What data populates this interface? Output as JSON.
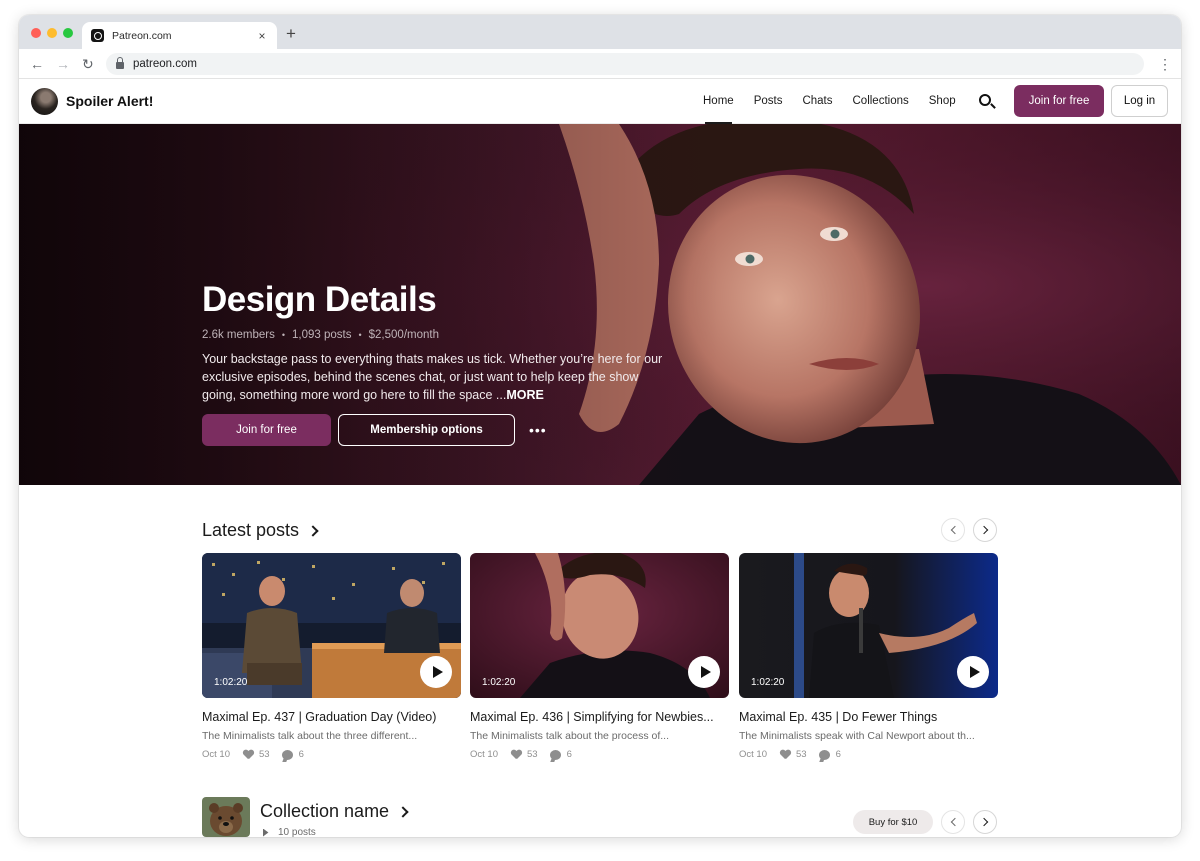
{
  "browser": {
    "tab_title": "Patreon.com",
    "tab_close": "×",
    "new_tab": "+",
    "url": "patreon.com",
    "back": "←",
    "forward": "→",
    "reload": "↻",
    "menu": "⋮"
  },
  "header": {
    "brand": "Spoiler Alert!",
    "nav": [
      "Home",
      "Posts",
      "Chats",
      "Collections",
      "Shop"
    ],
    "active_nav": "Home",
    "join_label": "Join for free",
    "login_label": "Log in"
  },
  "hero": {
    "title": "Design Details",
    "members": "2.6k members",
    "posts": "1,093 posts",
    "price": "$2,500/month",
    "separator": "•",
    "description": "Your backstage pass to everything thats makes us tick. Whether you’re here for our exclusive episodes, behind the scenes chat, or just want to help keep the show going, something more word go here to fill the space ...",
    "more_label": "MORE",
    "join_label": "Join for free",
    "membership_label": "Membership options",
    "more_dots": "•••"
  },
  "latest_posts": {
    "title": "Latest posts",
    "posts": [
      {
        "duration": "1:02:20",
        "title": "Maximal Ep. 437 | Graduation Day (Video)",
        "description": "The Minimalists talk about the three different...",
        "date": "Oct 10",
        "likes": "53",
        "comments": "6"
      },
      {
        "duration": "1:02:20",
        "title": "Maximal Ep. 436 | Simplifying for Newbies...",
        "description": "The Minimalists talk about the process of...",
        "date": "Oct 10",
        "likes": "53",
        "comments": "6"
      },
      {
        "duration": "1:02:20",
        "title": "Maximal Ep. 435 | Do Fewer Things",
        "description": "The Minimalists speak with Cal Newport about th...",
        "date": "Oct 10",
        "likes": "53",
        "comments": "6"
      }
    ]
  },
  "collection": {
    "title": "Collection name",
    "count": "10 posts",
    "buy_label": "Buy for $10"
  },
  "colors": {
    "accent": "#7b2d60",
    "hero_bg": "#45182a"
  }
}
